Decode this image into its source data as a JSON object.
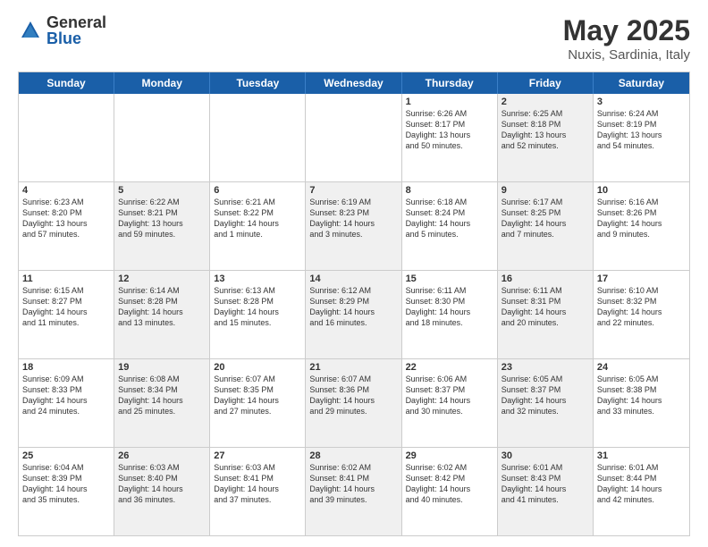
{
  "logo": {
    "general": "General",
    "blue": "Blue"
  },
  "title": {
    "month": "May 2025",
    "location": "Nuxis, Sardinia, Italy"
  },
  "header_days": [
    "Sunday",
    "Monday",
    "Tuesday",
    "Wednesday",
    "Thursday",
    "Friday",
    "Saturday"
  ],
  "rows": [
    [
      {
        "day": "",
        "info": "",
        "shaded": false
      },
      {
        "day": "",
        "info": "",
        "shaded": false
      },
      {
        "day": "",
        "info": "",
        "shaded": false
      },
      {
        "day": "",
        "info": "",
        "shaded": false
      },
      {
        "day": "1",
        "info": "Sunrise: 6:26 AM\nSunset: 8:17 PM\nDaylight: 13 hours\nand 50 minutes.",
        "shaded": false
      },
      {
        "day": "2",
        "info": "Sunrise: 6:25 AM\nSunset: 8:18 PM\nDaylight: 13 hours\nand 52 minutes.",
        "shaded": true
      },
      {
        "day": "3",
        "info": "Sunrise: 6:24 AM\nSunset: 8:19 PM\nDaylight: 13 hours\nand 54 minutes.",
        "shaded": false
      }
    ],
    [
      {
        "day": "4",
        "info": "Sunrise: 6:23 AM\nSunset: 8:20 PM\nDaylight: 13 hours\nand 57 minutes.",
        "shaded": false
      },
      {
        "day": "5",
        "info": "Sunrise: 6:22 AM\nSunset: 8:21 PM\nDaylight: 13 hours\nand 59 minutes.",
        "shaded": true
      },
      {
        "day": "6",
        "info": "Sunrise: 6:21 AM\nSunset: 8:22 PM\nDaylight: 14 hours\nand 1 minute.",
        "shaded": false
      },
      {
        "day": "7",
        "info": "Sunrise: 6:19 AM\nSunset: 8:23 PM\nDaylight: 14 hours\nand 3 minutes.",
        "shaded": true
      },
      {
        "day": "8",
        "info": "Sunrise: 6:18 AM\nSunset: 8:24 PM\nDaylight: 14 hours\nand 5 minutes.",
        "shaded": false
      },
      {
        "day": "9",
        "info": "Sunrise: 6:17 AM\nSunset: 8:25 PM\nDaylight: 14 hours\nand 7 minutes.",
        "shaded": true
      },
      {
        "day": "10",
        "info": "Sunrise: 6:16 AM\nSunset: 8:26 PM\nDaylight: 14 hours\nand 9 minutes.",
        "shaded": false
      }
    ],
    [
      {
        "day": "11",
        "info": "Sunrise: 6:15 AM\nSunset: 8:27 PM\nDaylight: 14 hours\nand 11 minutes.",
        "shaded": false
      },
      {
        "day": "12",
        "info": "Sunrise: 6:14 AM\nSunset: 8:28 PM\nDaylight: 14 hours\nand 13 minutes.",
        "shaded": true
      },
      {
        "day": "13",
        "info": "Sunrise: 6:13 AM\nSunset: 8:28 PM\nDaylight: 14 hours\nand 15 minutes.",
        "shaded": false
      },
      {
        "day": "14",
        "info": "Sunrise: 6:12 AM\nSunset: 8:29 PM\nDaylight: 14 hours\nand 16 minutes.",
        "shaded": true
      },
      {
        "day": "15",
        "info": "Sunrise: 6:11 AM\nSunset: 8:30 PM\nDaylight: 14 hours\nand 18 minutes.",
        "shaded": false
      },
      {
        "day": "16",
        "info": "Sunrise: 6:11 AM\nSunset: 8:31 PM\nDaylight: 14 hours\nand 20 minutes.",
        "shaded": true
      },
      {
        "day": "17",
        "info": "Sunrise: 6:10 AM\nSunset: 8:32 PM\nDaylight: 14 hours\nand 22 minutes.",
        "shaded": false
      }
    ],
    [
      {
        "day": "18",
        "info": "Sunrise: 6:09 AM\nSunset: 8:33 PM\nDaylight: 14 hours\nand 24 minutes.",
        "shaded": false
      },
      {
        "day": "19",
        "info": "Sunrise: 6:08 AM\nSunset: 8:34 PM\nDaylight: 14 hours\nand 25 minutes.",
        "shaded": true
      },
      {
        "day": "20",
        "info": "Sunrise: 6:07 AM\nSunset: 8:35 PM\nDaylight: 14 hours\nand 27 minutes.",
        "shaded": false
      },
      {
        "day": "21",
        "info": "Sunrise: 6:07 AM\nSunset: 8:36 PM\nDaylight: 14 hours\nand 29 minutes.",
        "shaded": true
      },
      {
        "day": "22",
        "info": "Sunrise: 6:06 AM\nSunset: 8:37 PM\nDaylight: 14 hours\nand 30 minutes.",
        "shaded": false
      },
      {
        "day": "23",
        "info": "Sunrise: 6:05 AM\nSunset: 8:37 PM\nDaylight: 14 hours\nand 32 minutes.",
        "shaded": true
      },
      {
        "day": "24",
        "info": "Sunrise: 6:05 AM\nSunset: 8:38 PM\nDaylight: 14 hours\nand 33 minutes.",
        "shaded": false
      }
    ],
    [
      {
        "day": "25",
        "info": "Sunrise: 6:04 AM\nSunset: 8:39 PM\nDaylight: 14 hours\nand 35 minutes.",
        "shaded": false
      },
      {
        "day": "26",
        "info": "Sunrise: 6:03 AM\nSunset: 8:40 PM\nDaylight: 14 hours\nand 36 minutes.",
        "shaded": true
      },
      {
        "day": "27",
        "info": "Sunrise: 6:03 AM\nSunset: 8:41 PM\nDaylight: 14 hours\nand 37 minutes.",
        "shaded": false
      },
      {
        "day": "28",
        "info": "Sunrise: 6:02 AM\nSunset: 8:41 PM\nDaylight: 14 hours\nand 39 minutes.",
        "shaded": true
      },
      {
        "day": "29",
        "info": "Sunrise: 6:02 AM\nSunset: 8:42 PM\nDaylight: 14 hours\nand 40 minutes.",
        "shaded": false
      },
      {
        "day": "30",
        "info": "Sunrise: 6:01 AM\nSunset: 8:43 PM\nDaylight: 14 hours\nand 41 minutes.",
        "shaded": true
      },
      {
        "day": "31",
        "info": "Sunrise: 6:01 AM\nSunset: 8:44 PM\nDaylight: 14 hours\nand 42 minutes.",
        "shaded": false
      }
    ]
  ]
}
